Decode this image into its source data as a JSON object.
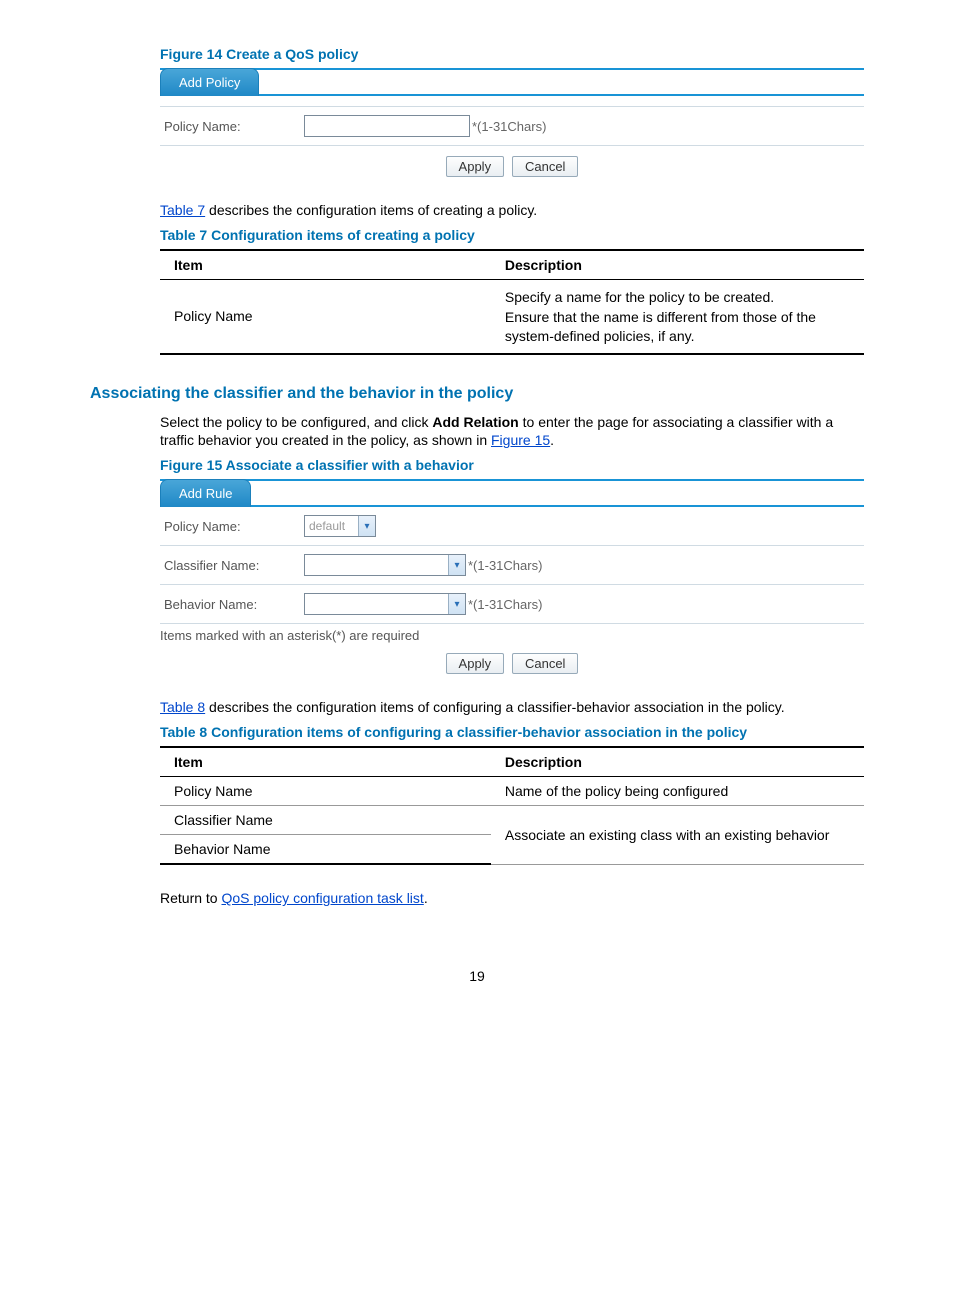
{
  "figure14": {
    "caption": "Figure 14 Create a QoS policy",
    "tab": "Add Policy",
    "policyNameLabel": "Policy Name:",
    "hint": "*(1-31Chars)",
    "applyBtn": "Apply",
    "cancelBtn": "Cancel"
  },
  "para1": {
    "link": "Table 7",
    "text": " describes the configuration items of creating a policy."
  },
  "table7": {
    "caption": "Table 7 Configuration items of creating a policy",
    "head": {
      "item": "Item",
      "desc": "Description"
    },
    "row1": {
      "item": "Policy Name",
      "desc1": "Specify a name for the policy to be created.",
      "desc2": "Ensure that the name is different from those of the system-defined policies, if any."
    }
  },
  "heading2": "Associating the classifier and the behavior in the policy",
  "para2": {
    "pre": "Select the policy to be configured, and click ",
    "bold": "Add Relation",
    "mid": " to enter the page for associating a classifier with a traffic behavior you created in the policy, as shown in ",
    "link": "Figure 15",
    "post": "."
  },
  "figure15": {
    "caption": "Figure 15 Associate a classifier with a behavior",
    "tab": "Add Rule",
    "policyNameLabel": "Policy Name:",
    "policyNameValue": "default",
    "classifierLabel": "Classifier Name:",
    "behaviorLabel": "Behavior Name:",
    "hint": "*(1-31Chars)",
    "requiredNote": "Items marked with an asterisk(*) are required",
    "applyBtn": "Apply",
    "cancelBtn": "Cancel"
  },
  "para3": {
    "link": "Table 8",
    "text": " describes the configuration items of configuring a classifier-behavior association in the policy."
  },
  "table8": {
    "caption": "Table 8 Configuration items of configuring a classifier-behavior association in the policy",
    "head": {
      "item": "Item",
      "desc": "Description"
    },
    "rows": [
      {
        "item": "Policy Name",
        "desc": "Name of the policy being configured"
      },
      {
        "item": "Classifier Name",
        "desc": "Associate an existing class with an existing behavior"
      },
      {
        "item": "Behavior Name",
        "desc": ""
      }
    ]
  },
  "returnPara": {
    "pre": "Return to ",
    "link": "QoS policy configuration task list",
    "post": "."
  },
  "pageNumber": "19"
}
